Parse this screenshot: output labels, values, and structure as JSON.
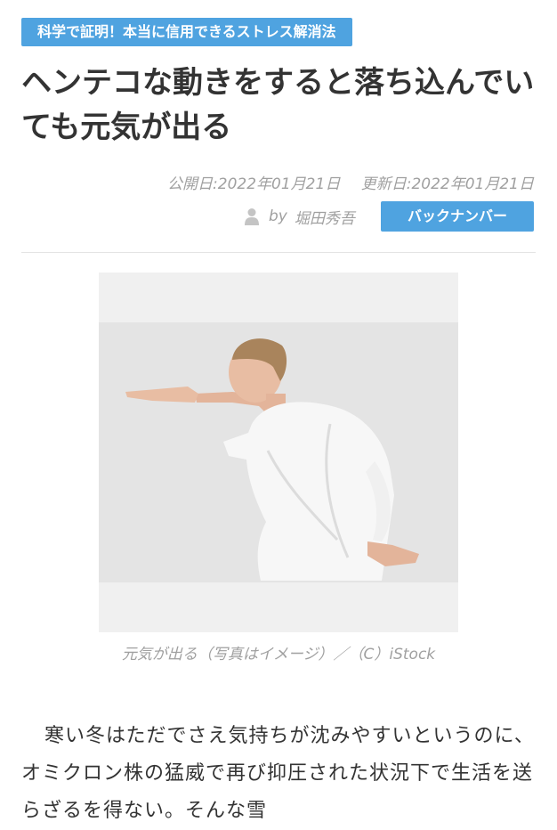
{
  "category": "科学で証明！本当に信用できるストレス解消法",
  "title": "ヘンテコな動きをすると落ち込んでいても元気が出る",
  "published": "公開日:2022年01月21日",
  "updated": "更新日:2022年01月21日",
  "author": {
    "prefix": "by",
    "name": "堀田秀吾",
    "icon": "person-icon"
  },
  "backnumber_label": "バックナンバー",
  "photo_caption": "元気が出る（写真はイメージ）／（C）iStock",
  "body": "寒い冬はただでさえ気持ちが沈みやすいというのに、オミクロン株の猛威で再び抑圧された状況下で生活を送らざるを得ない。そんな雪",
  "colors": {
    "accent": "#4fa3e0",
    "muted": "#a0a0a0",
    "text": "#333333"
  }
}
